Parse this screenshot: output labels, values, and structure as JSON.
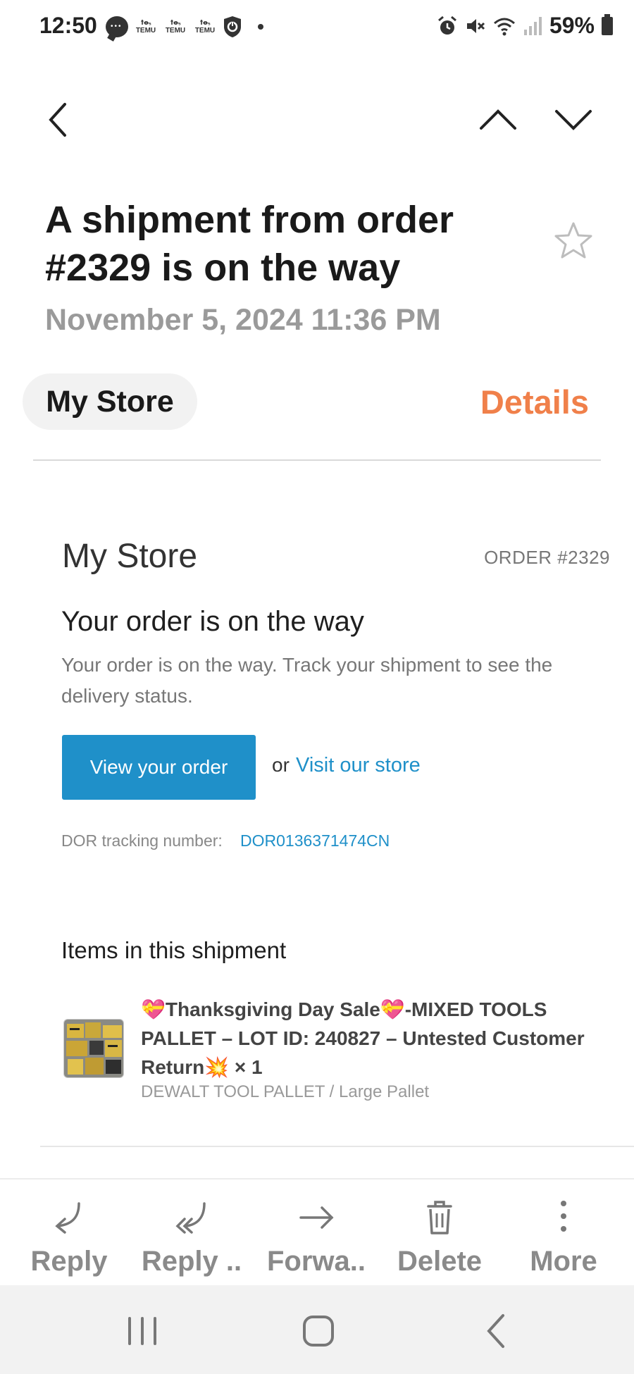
{
  "status_bar": {
    "time": "12:50",
    "notification_icons": [
      "message-icon",
      "temu-icon",
      "temu-icon",
      "temu-icon",
      "shield-icon"
    ],
    "temu_label": "TEMU",
    "right_icons": [
      "alarm-icon",
      "mute-icon",
      "wifi-icon",
      "signal-icon"
    ],
    "battery_percent": "59%"
  },
  "email": {
    "subject": "A shipment from order #2329 is on the way",
    "date": "November 5, 2024  11:36 PM",
    "sender": "My Store",
    "details_label": "Details"
  },
  "body": {
    "store_name": "My Store",
    "order_number": "ORDER #2329",
    "heading": "Your order is on the way",
    "description": "Your order is on the way. Track your shipment to see the delivery status.",
    "view_order_label": "View your order",
    "or_text": "or",
    "visit_store_label": "Visit our store",
    "tracking_label": "DOR tracking number:",
    "tracking_number": "DOR0136371474CN",
    "items_heading": "Items in this shipment",
    "item": {
      "title": "💝Thanksgiving Day Sale💝-MIXED TOOLS PALLET – LOT ID: 240827 – Untested Customer Return💥 × 1",
      "variant": "DEWALT TOOL PALLET / Large Pallet"
    }
  },
  "actions": {
    "reply": "Reply",
    "reply_all": "Reply ..",
    "forward": "Forwa..",
    "delete": "Delete",
    "more": "More"
  },
  "colors": {
    "accent_orange": "#f0804a",
    "link_blue": "#1f90c9",
    "button_blue": "#1f90c9"
  }
}
